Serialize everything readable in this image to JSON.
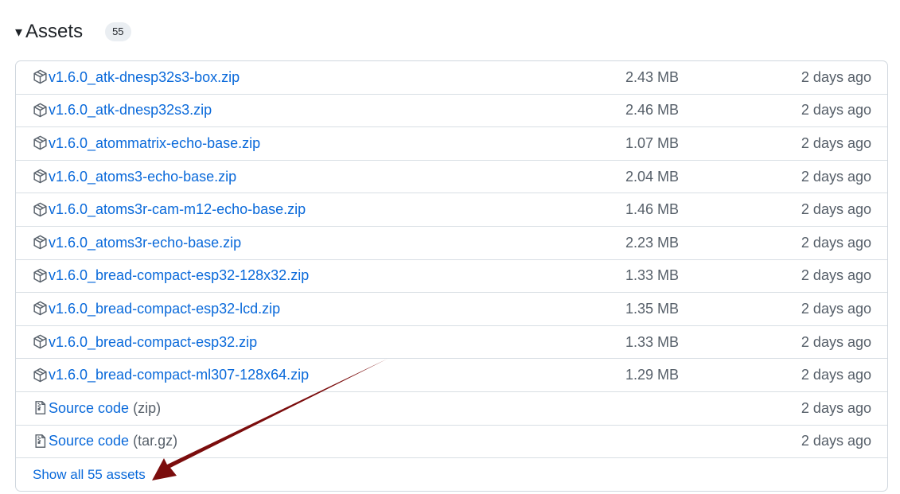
{
  "header": {
    "toggle": "▾",
    "title": "Assets",
    "count": "55"
  },
  "assets": [
    {
      "name": "v1.6.0_atk-dnesp32s3-box.zip",
      "size": "2.43 MB",
      "date": "2 days ago",
      "icon": "package-icon"
    },
    {
      "name": "v1.6.0_atk-dnesp32s3.zip",
      "size": "2.46 MB",
      "date": "2 days ago",
      "icon": "package-icon"
    },
    {
      "name": "v1.6.0_atommatrix-echo-base.zip",
      "size": "1.07 MB",
      "date": "2 days ago",
      "icon": "package-icon"
    },
    {
      "name": "v1.6.0_atoms3-echo-base.zip",
      "size": "2.04 MB",
      "date": "2 days ago",
      "icon": "package-icon"
    },
    {
      "name": "v1.6.0_atoms3r-cam-m12-echo-base.zip",
      "size": "1.46 MB",
      "date": "2 days ago",
      "icon": "package-icon"
    },
    {
      "name": "v1.6.0_atoms3r-echo-base.zip",
      "size": "2.23 MB",
      "date": "2 days ago",
      "icon": "package-icon"
    },
    {
      "name": "v1.6.0_bread-compact-esp32-128x32.zip",
      "size": "1.33 MB",
      "date": "2 days ago",
      "icon": "package-icon"
    },
    {
      "name": "v1.6.0_bread-compact-esp32-lcd.zip",
      "size": "1.35 MB",
      "date": "2 days ago",
      "icon": "package-icon"
    },
    {
      "name": "v1.6.0_bread-compact-esp32.zip",
      "size": "1.33 MB",
      "date": "2 days ago",
      "icon": "package-icon"
    },
    {
      "name": "v1.6.0_bread-compact-ml307-128x64.zip",
      "size": "1.29 MB",
      "date": "2 days ago",
      "icon": "package-icon"
    }
  ],
  "source_code": [
    {
      "label": "Source code",
      "ext": "(zip)",
      "date": "2 days ago",
      "icon": "file-zip-icon"
    },
    {
      "label": "Source code",
      "ext": "(tar.gz)",
      "date": "2 days ago",
      "icon": "file-zip-icon"
    }
  ],
  "show_all": "Show all 55 assets",
  "colors": {
    "link": "#0969da",
    "muted": "#57606a",
    "border": "#d0d7de",
    "arrow": "#7b0d0d"
  }
}
